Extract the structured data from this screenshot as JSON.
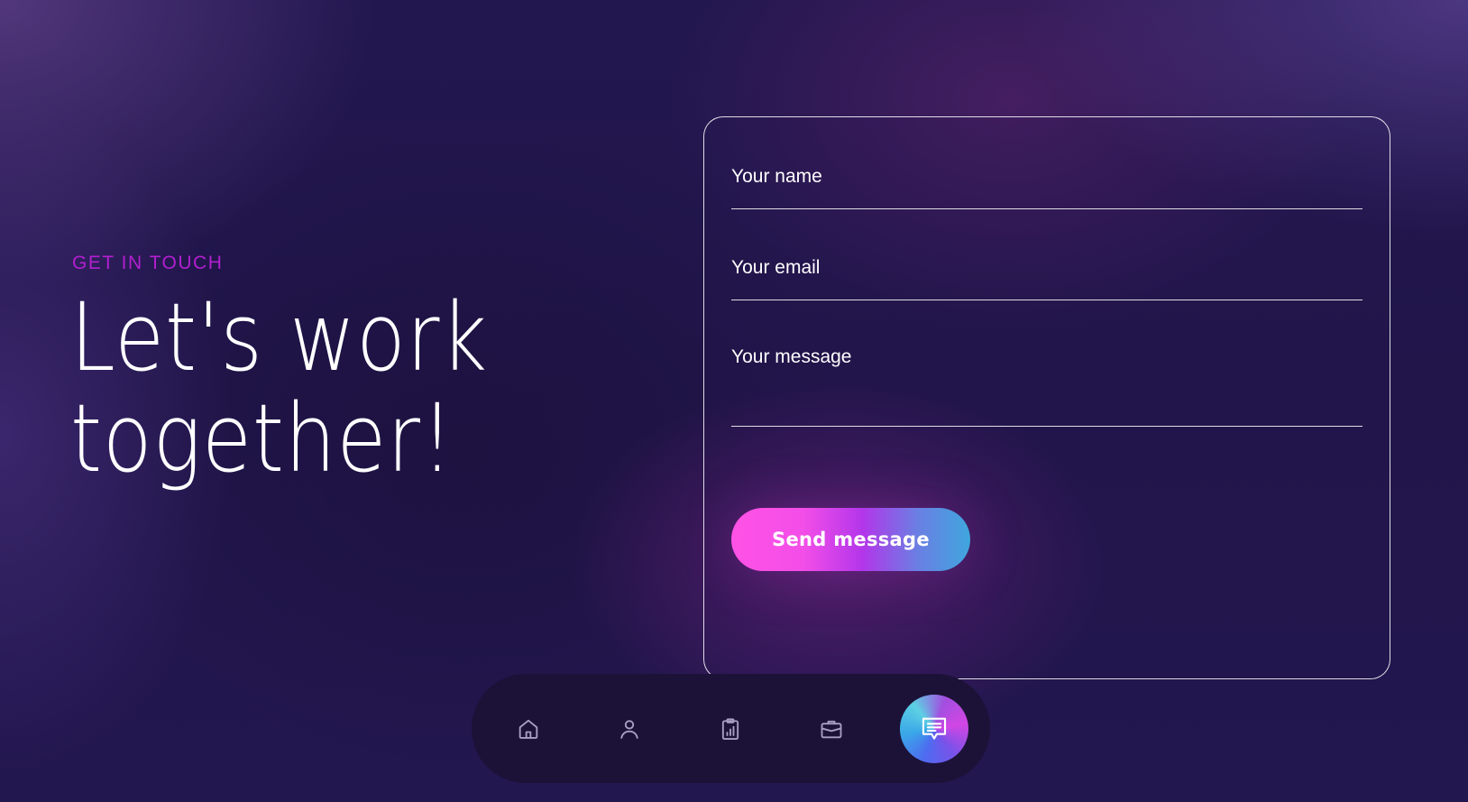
{
  "hero": {
    "eyebrow": "GET IN TOUCH",
    "headline_line1": "Let's work",
    "headline_line2": "together!"
  },
  "form": {
    "name_placeholder": "Your name",
    "email_placeholder": "Your email",
    "message_placeholder": "Your message",
    "submit_label": "Send message"
  },
  "nav": {
    "items": [
      {
        "icon": "home-icon",
        "active": false
      },
      {
        "icon": "user-icon",
        "active": false
      },
      {
        "icon": "clipboard-chart-icon",
        "active": false
      },
      {
        "icon": "briefcase-icon",
        "active": false
      },
      {
        "icon": "chat-bubble-icon",
        "active": true
      }
    ]
  },
  "colors": {
    "accent": "#b21fd0",
    "button_gradient_start": "#ff52e6",
    "button_gradient_end": "#3fa6de",
    "background": "#21164d"
  }
}
